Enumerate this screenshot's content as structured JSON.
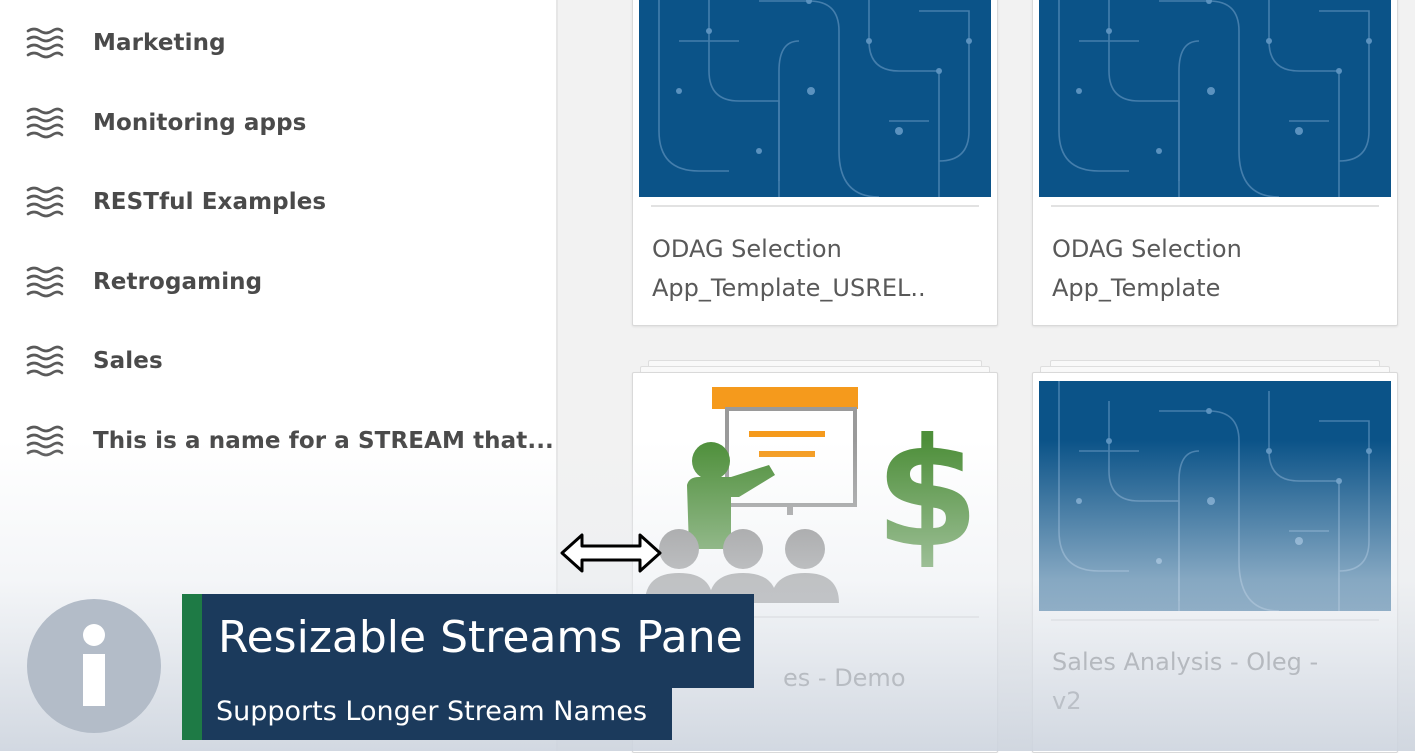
{
  "streams_pane": {
    "items": [
      {
        "label": "Marketing"
      },
      {
        "label": "Monitoring apps"
      },
      {
        "label": "RESTful Examples"
      },
      {
        "label": "Retrogaming"
      },
      {
        "label": "Sales"
      },
      {
        "label": "This is a name for a STREAM that..."
      }
    ],
    "icon": "stream-icon"
  },
  "apps": [
    {
      "title": "ODAG Selection\nApp_Template_USREL..",
      "thumbnail": "circuit-pattern"
    },
    {
      "title": "ODAG Selection\nApp_Template",
      "thumbnail": "circuit-pattern"
    },
    {
      "title": "es - Demo",
      "thumbnail": "presentation-dollar"
    },
    {
      "title": "Sales Analysis - Oleg -\nv2",
      "thumbnail": "circuit-pattern"
    }
  ],
  "overlay": {
    "title": "Resizable Streams Pane",
    "subtitle": "Supports Longer Stream Names",
    "icon": "info-icon"
  },
  "colors": {
    "thumb_blue": "#0b5388",
    "accent_green": "#1e7a45",
    "banner_navy": "#1b3a5c",
    "sales_green": "#4e8f3a",
    "board_orange": "#f59a1c"
  },
  "cursor": "resize-horizontal-icon"
}
